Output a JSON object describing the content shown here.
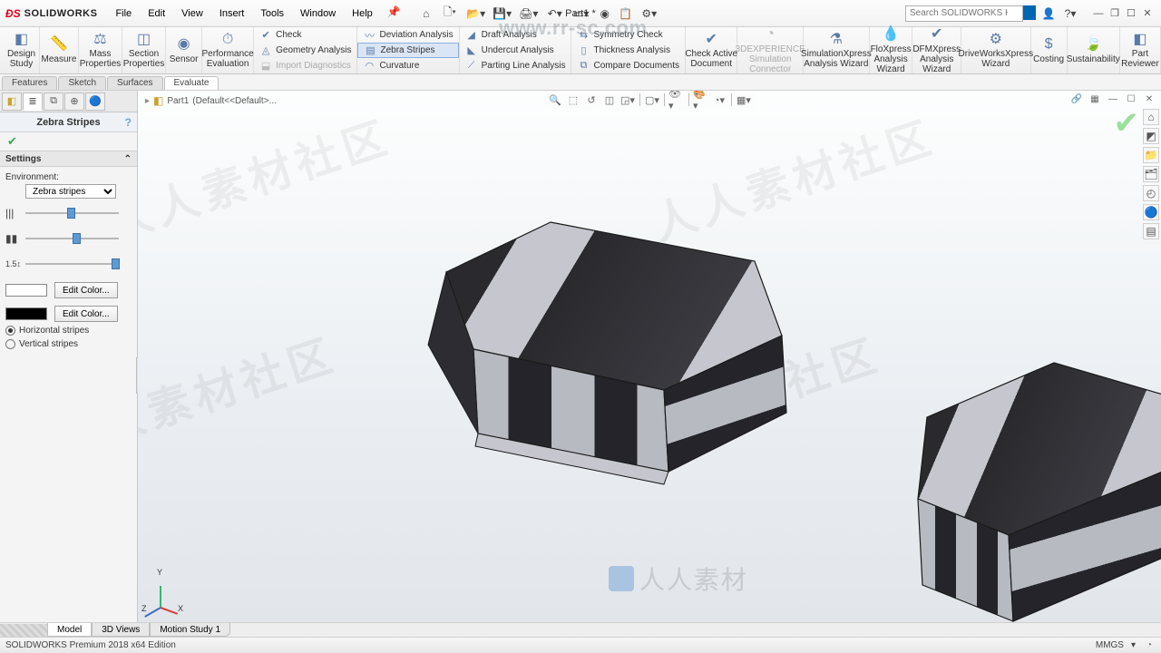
{
  "app": {
    "brand": "SOLIDWORKS",
    "doc_title": "Part1 *"
  },
  "menu": [
    "File",
    "Edit",
    "View",
    "Insert",
    "Tools",
    "Window",
    "Help"
  ],
  "search": {
    "placeholder": "Search SOLIDWORKS Help"
  },
  "ribbon": {
    "big": [
      {
        "key": "design-study",
        "label": "Design\nStudy"
      },
      {
        "key": "measure",
        "label": "Measure"
      },
      {
        "key": "mass-props",
        "label": "Mass\nProperties"
      },
      {
        "key": "section-props",
        "label": "Section\nProperties"
      },
      {
        "key": "sensor",
        "label": "Sensor"
      },
      {
        "key": "perf-eval",
        "label": "Performance\nEvaluation"
      }
    ],
    "col1": [
      {
        "key": "check",
        "label": "Check"
      },
      {
        "key": "geom",
        "label": "Geometry Analysis"
      },
      {
        "key": "import-diag",
        "label": "Import Diagnostics",
        "disabled": true
      }
    ],
    "col2": [
      {
        "key": "deviation",
        "label": "Deviation Analysis"
      },
      {
        "key": "zebra",
        "label": "Zebra Stripes",
        "active": true
      },
      {
        "key": "curvature",
        "label": "Curvature"
      }
    ],
    "col3": [
      {
        "key": "draft",
        "label": "Draft Analysis"
      },
      {
        "key": "undercut",
        "label": "Undercut Analysis"
      },
      {
        "key": "parting",
        "label": "Parting Line Analysis"
      }
    ],
    "col4": [
      {
        "key": "symmetry",
        "label": "Symmetry Check"
      },
      {
        "key": "thickness",
        "label": "Thickness Analysis"
      },
      {
        "key": "compare",
        "label": "Compare Documents"
      }
    ],
    "big2": [
      {
        "key": "check-active",
        "label": "Check Active\nDocument"
      },
      {
        "key": "3dexp",
        "label": "3DEXPERIENCE\nSimulation\nConnector",
        "disabled": true
      },
      {
        "key": "simxpress",
        "label": "SimulationXpress\nAnalysis Wizard"
      },
      {
        "key": "floxpress",
        "label": "FloXpress\nAnalysis\nWizard"
      },
      {
        "key": "dfmxpress",
        "label": "DFMXpress\nAnalysis\nWizard"
      },
      {
        "key": "drivexpress",
        "label": "DriveWorksXpress\nWizard"
      },
      {
        "key": "costing",
        "label": "Costing"
      },
      {
        "key": "sustain",
        "label": "Sustainability"
      },
      {
        "key": "partrev",
        "label": "Part\nReviewer"
      }
    ]
  },
  "doc_tabs": [
    "Features",
    "Sketch",
    "Surfaces",
    "Evaluate"
  ],
  "doc_tabs_active": 3,
  "pm": {
    "title": "Zebra Stripes",
    "section": "Settings",
    "env_label": "Environment:",
    "env_value": "Zebra stripes",
    "edit_color": "Edit Color...",
    "horiz": "Horizontal stripes",
    "vert": "Vertical stripes",
    "color1": "#ffffff",
    "color2": "#000000",
    "slider1": 45,
    "slider2": 50,
    "slider3": 92
  },
  "crumb": {
    "part": "Part1",
    "config": "(Default<<Default>..."
  },
  "sheet_tabs": [
    "Model",
    "3D Views",
    "Motion Study 1"
  ],
  "sheet_tabs_active": 0,
  "status": {
    "left": "SOLIDWORKS Premium 2018 x64 Edition",
    "units": "MMGS"
  },
  "watermark_url": "www.rr-sc.com",
  "watermark2": "人人素材"
}
